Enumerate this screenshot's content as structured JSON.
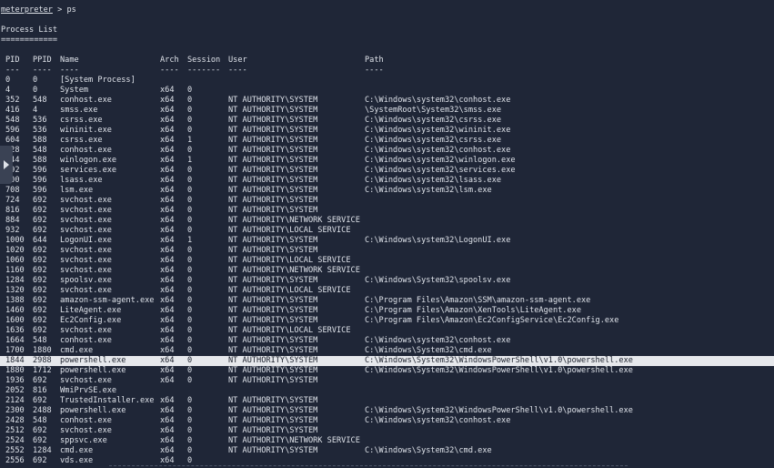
{
  "top_partial": "          ---   --  -  -",
  "command": {
    "prompt": "meterpreter",
    "input": " > ps"
  },
  "title": "Process List",
  "title_underline": "============",
  "columns": {
    "pid": "PID",
    "ppid": "PPID",
    "name": "Name",
    "arch": "Arch",
    "session": "Session",
    "user": "User",
    "path": "Path"
  },
  "separators": {
    "pid": "---",
    "ppid": "----",
    "name": "----",
    "arch": "----",
    "session": "-------",
    "user": "----",
    "path": "----"
  },
  "processes": [
    {
      "pid": "0",
      "ppid": "0",
      "name": "[System Process]",
      "arch": "",
      "session": "",
      "user": "",
      "path": ""
    },
    {
      "pid": "4",
      "ppid": "0",
      "name": "System",
      "arch": "x64",
      "session": "0",
      "user": "",
      "path": ""
    },
    {
      "pid": "352",
      "ppid": "548",
      "name": "conhost.exe",
      "arch": "x64",
      "session": "0",
      "user": "NT AUTHORITY\\SYSTEM",
      "path": "C:\\Windows\\system32\\conhost.exe"
    },
    {
      "pid": "416",
      "ppid": "4",
      "name": "smss.exe",
      "arch": "x64",
      "session": "0",
      "user": "NT AUTHORITY\\SYSTEM",
      "path": "\\SystemRoot\\System32\\smss.exe"
    },
    {
      "pid": "548",
      "ppid": "536",
      "name": "csrss.exe",
      "arch": "x64",
      "session": "0",
      "user": "NT AUTHORITY\\SYSTEM",
      "path": "C:\\Windows\\system32\\csrss.exe"
    },
    {
      "pid": "596",
      "ppid": "536",
      "name": "wininit.exe",
      "arch": "x64",
      "session": "0",
      "user": "NT AUTHORITY\\SYSTEM",
      "path": "C:\\Windows\\system32\\wininit.exe"
    },
    {
      "pid": "604",
      "ppid": "588",
      "name": "csrss.exe",
      "arch": "x64",
      "session": "1",
      "user": "NT AUTHORITY\\SYSTEM",
      "path": "C:\\Windows\\system32\\csrss.exe"
    },
    {
      "pid": "628",
      "ppid": "548",
      "name": "conhost.exe",
      "arch": "x64",
      "session": "0",
      "user": "NT AUTHORITY\\SYSTEM",
      "path": "C:\\Windows\\system32\\conhost.exe"
    },
    {
      "pid": "644",
      "ppid": "588",
      "name": "winlogon.exe",
      "arch": "x64",
      "session": "1",
      "user": "NT AUTHORITY\\SYSTEM",
      "path": "C:\\Windows\\system32\\winlogon.exe"
    },
    {
      "pid": "692",
      "ppid": "596",
      "name": "services.exe",
      "arch": "x64",
      "session": "0",
      "user": "NT AUTHORITY\\SYSTEM",
      "path": "C:\\Windows\\system32\\services.exe"
    },
    {
      "pid": "700",
      "ppid": "596",
      "name": "lsass.exe",
      "arch": "x64",
      "session": "0",
      "user": "NT AUTHORITY\\SYSTEM",
      "path": "C:\\Windows\\system32\\lsass.exe"
    },
    {
      "pid": "708",
      "ppid": "596",
      "name": "lsm.exe",
      "arch": "x64",
      "session": "0",
      "user": "NT AUTHORITY\\SYSTEM",
      "path": "C:\\Windows\\system32\\lsm.exe"
    },
    {
      "pid": "724",
      "ppid": "692",
      "name": "svchost.exe",
      "arch": "x64",
      "session": "0",
      "user": "NT AUTHORITY\\SYSTEM",
      "path": ""
    },
    {
      "pid": "816",
      "ppid": "692",
      "name": "svchost.exe",
      "arch": "x64",
      "session": "0",
      "user": "NT AUTHORITY\\SYSTEM",
      "path": ""
    },
    {
      "pid": "884",
      "ppid": "692",
      "name": "svchost.exe",
      "arch": "x64",
      "session": "0",
      "user": "NT AUTHORITY\\NETWORK SERVICE",
      "path": ""
    },
    {
      "pid": "932",
      "ppid": "692",
      "name": "svchost.exe",
      "arch": "x64",
      "session": "0",
      "user": "NT AUTHORITY\\LOCAL SERVICE",
      "path": ""
    },
    {
      "pid": "1000",
      "ppid": "644",
      "name": "LogonUI.exe",
      "arch": "x64",
      "session": "1",
      "user": "NT AUTHORITY\\SYSTEM",
      "path": "C:\\Windows\\system32\\LogonUI.exe"
    },
    {
      "pid": "1020",
      "ppid": "692",
      "name": "svchost.exe",
      "arch": "x64",
      "session": "0",
      "user": "NT AUTHORITY\\SYSTEM",
      "path": ""
    },
    {
      "pid": "1060",
      "ppid": "692",
      "name": "svchost.exe",
      "arch": "x64",
      "session": "0",
      "user": "NT AUTHORITY\\LOCAL SERVICE",
      "path": ""
    },
    {
      "pid": "1160",
      "ppid": "692",
      "name": "svchost.exe",
      "arch": "x64",
      "session": "0",
      "user": "NT AUTHORITY\\NETWORK SERVICE",
      "path": ""
    },
    {
      "pid": "1284",
      "ppid": "692",
      "name": "spoolsv.exe",
      "arch": "x64",
      "session": "0",
      "user": "NT AUTHORITY\\SYSTEM",
      "path": "C:\\Windows\\System32\\spoolsv.exe"
    },
    {
      "pid": "1320",
      "ppid": "692",
      "name": "svchost.exe",
      "arch": "x64",
      "session": "0",
      "user": "NT AUTHORITY\\LOCAL SERVICE",
      "path": ""
    },
    {
      "pid": "1388",
      "ppid": "692",
      "name": "amazon-ssm-agent.exe",
      "arch": "x64",
      "session": "0",
      "user": "NT AUTHORITY\\SYSTEM",
      "path": "C:\\Program Files\\Amazon\\SSM\\amazon-ssm-agent.exe"
    },
    {
      "pid": "1460",
      "ppid": "692",
      "name": "LiteAgent.exe",
      "arch": "x64",
      "session": "0",
      "user": "NT AUTHORITY\\SYSTEM",
      "path": "C:\\Program Files\\Amazon\\XenTools\\LiteAgent.exe"
    },
    {
      "pid": "1600",
      "ppid": "692",
      "name": "Ec2Config.exe",
      "arch": "x64",
      "session": "0",
      "user": "NT AUTHORITY\\SYSTEM",
      "path": "C:\\Program Files\\Amazon\\Ec2ConfigService\\Ec2Config.exe"
    },
    {
      "pid": "1636",
      "ppid": "692",
      "name": "svchost.exe",
      "arch": "x64",
      "session": "0",
      "user": "NT AUTHORITY\\LOCAL SERVICE",
      "path": ""
    },
    {
      "pid": "1664",
      "ppid": "548",
      "name": "conhost.exe",
      "arch": "x64",
      "session": "0",
      "user": "NT AUTHORITY\\SYSTEM",
      "path": "C:\\Windows\\system32\\conhost.exe"
    },
    {
      "pid": "1700",
      "ppid": "1880",
      "name": "cmd.exe",
      "arch": "x64",
      "session": "0",
      "user": "NT AUTHORITY\\SYSTEM",
      "path": "C:\\Windows\\System32\\cmd.exe"
    },
    {
      "pid": "1844",
      "ppid": "2988",
      "name": "powershell.exe",
      "arch": "x64",
      "session": "0",
      "user": "NT AUTHORITY\\SYSTEM",
      "path": "C:\\Windows\\System32\\WindowsPowerShell\\v1.0\\powershell.exe",
      "highlighted": true
    },
    {
      "pid": "1880",
      "ppid": "1712",
      "name": "powershell.exe",
      "arch": "x64",
      "session": "0",
      "user": "NT AUTHORITY\\SYSTEM",
      "path": "C:\\Windows\\System32\\WindowsPowerShell\\v1.0\\powershell.exe"
    },
    {
      "pid": "1936",
      "ppid": "692",
      "name": "svchost.exe",
      "arch": "x64",
      "session": "0",
      "user": "NT AUTHORITY\\SYSTEM",
      "path": ""
    },
    {
      "pid": "2052",
      "ppid": "816",
      "name": "WmiPrvSE.exe",
      "arch": "",
      "session": "",
      "user": "",
      "path": ""
    },
    {
      "pid": "2124",
      "ppid": "692",
      "name": "TrustedInstaller.exe",
      "arch": "x64",
      "session": "0",
      "user": "NT AUTHORITY\\SYSTEM",
      "path": ""
    },
    {
      "pid": "2300",
      "ppid": "2488",
      "name": "powershell.exe",
      "arch": "x64",
      "session": "0",
      "user": "NT AUTHORITY\\SYSTEM",
      "path": "C:\\Windows\\System32\\WindowsPowerShell\\v1.0\\powershell.exe"
    },
    {
      "pid": "2428",
      "ppid": "548",
      "name": "conhost.exe",
      "arch": "x64",
      "session": "0",
      "user": "NT AUTHORITY\\SYSTEM",
      "path": "C:\\Windows\\system32\\conhost.exe"
    },
    {
      "pid": "2512",
      "ppid": "692",
      "name": "svchost.exe",
      "arch": "x64",
      "session": "0",
      "user": "NT AUTHORITY\\SYSTEM",
      "path": ""
    },
    {
      "pid": "2524",
      "ppid": "692",
      "name": "sppsvc.exe",
      "arch": "x64",
      "session": "0",
      "user": "NT AUTHORITY\\NETWORK SERVICE",
      "path": ""
    },
    {
      "pid": "2552",
      "ppid": "1284",
      "name": "cmd.exe",
      "arch": "x64",
      "session": "0",
      "user": "NT AUTHORITY\\SYSTEM",
      "path": "C:\\Windows\\System32\\cmd.exe"
    },
    {
      "pid": "2556",
      "ppid": "692",
      "name": "vds.exe",
      "arch": "x64",
      "session": "0",
      "user": "",
      "path": ""
    }
  ],
  "side_handle_icon": "chevron-right-icon",
  "colors": {
    "background": "#1f2637",
    "text": "#dfe3ea",
    "highlight_bg": "#e6e8ec",
    "highlight_text": "#1a1f2b"
  }
}
